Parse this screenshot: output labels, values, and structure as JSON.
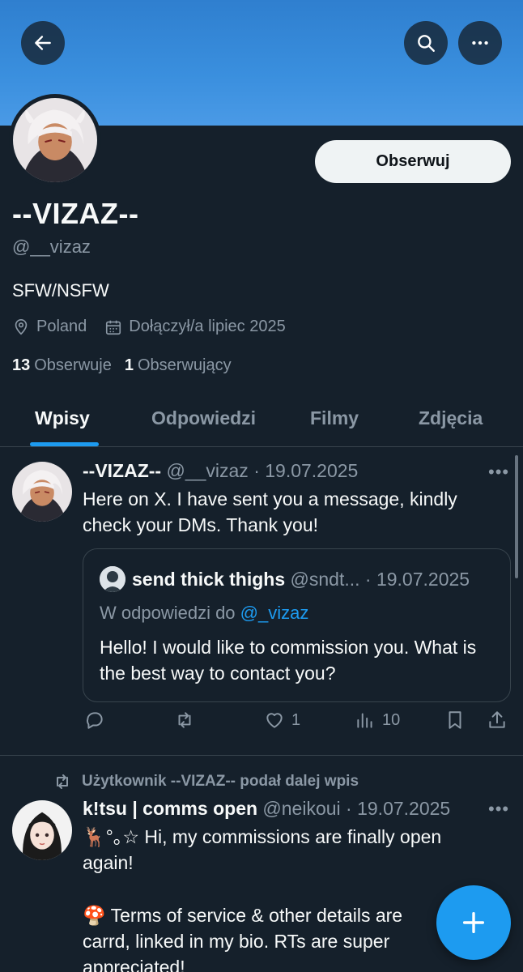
{
  "profile": {
    "display_name": "--VIZAZ--",
    "handle": "@__vizaz",
    "bio": "SFW/NSFW",
    "location": "Poland",
    "joined": "Dołączył/a lipiec 2025",
    "following_count": "13",
    "following_label": "Obserwuje",
    "followers_count": "1",
    "followers_label": "Obserwujący",
    "follow_button": "Obserwuj"
  },
  "tabs": [
    "Wpisy",
    "Odpowiedzi",
    "Filmy",
    "Zdjęcia"
  ],
  "tweets": [
    {
      "name": "--VIZAZ--",
      "meta": "@__vizaz · 19.07.2025",
      "text": "Here on X. I have sent you a message, kindly check your DMs. Thank you!",
      "quote": {
        "name": "send thick thighs",
        "meta": "@sndt... · 19.07.2025",
        "reply_prefix": "W odpowiedzi do ",
        "reply_handle": "@_vizaz",
        "text": "Hello! I would like to commission you. What is the best way to contact you?"
      },
      "actions": {
        "replies": "",
        "retweets": "",
        "likes": "1",
        "views": "10"
      }
    },
    {
      "retweet_notice": "Użytkownik --VIZAZ-- podał dalej wpis",
      "name": "k!tsu | comms open",
      "meta": "@neikoui · 19.07.2025",
      "text_line1": "🦌°｡☆ Hi, my commissions are finally open again!",
      "text_line2": "🍄 Terms of service & other details are carrd, linked in my bio. RTs are super appreciated!"
    }
  ],
  "icons": {
    "back": "back-arrow-icon",
    "search": "search-icon",
    "more": "more-icon",
    "location": "location-pin-icon",
    "calendar": "calendar-icon",
    "reply": "reply-icon",
    "retweet": "retweet-icon",
    "like": "heart-icon",
    "views": "views-icon",
    "bookmark": "bookmark-icon",
    "share": "share-icon",
    "compose": "plus-icon"
  },
  "colors": {
    "accent": "#1d9bf0",
    "background": "#15202b",
    "banner": "#3a8fde",
    "muted": "#8b98a5"
  }
}
